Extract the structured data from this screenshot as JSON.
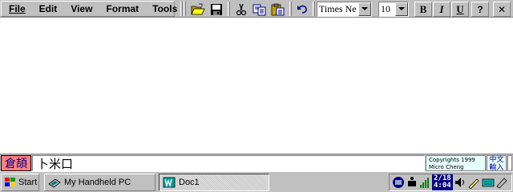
{
  "menu": {
    "items": [
      "File",
      "Edit",
      "View",
      "Format",
      "Tools"
    ]
  },
  "toolbar": {
    "font_name": "Times Ne",
    "font_size": "10",
    "bold_label": "B",
    "italic_label": "I",
    "underline_label": "U",
    "help_label": "?",
    "close_label": "✕"
  },
  "ime": {
    "mode_label": "倉頡",
    "input_text": "卜米口",
    "copyright_line1": "Copyrights 1999",
    "copyright_line2": "Micro Cheng",
    "switch_line1": "中文",
    "switch_line2": "輸入"
  },
  "taskbar": {
    "start_label": "Start",
    "tasks": [
      "My Handheld PC",
      "Doc1"
    ],
    "clock_date": "2/18",
    "clock_time": "4:04"
  },
  "colors": {
    "face": "#c0c0c0",
    "shadow": "#808080",
    "highlight": "#ffffff",
    "ime_mode_bg": "#ff8080",
    "clock_bg": "#000080"
  }
}
